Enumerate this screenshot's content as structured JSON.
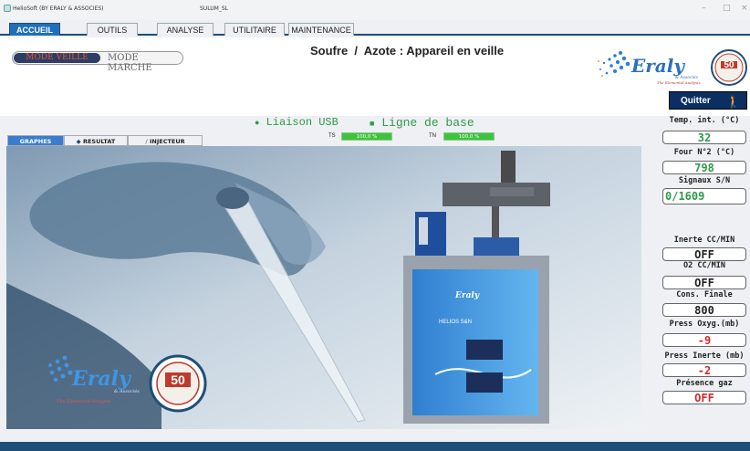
{
  "window": {
    "app_title": "HelioSoft (BY ERALY & ASSOCIES)",
    "file_name": "SULUM_SL"
  },
  "menu": {
    "tabs": [
      {
        "label": "ACCUEIL",
        "active": true
      },
      {
        "label": "OUTILS",
        "active": false
      },
      {
        "label": "ANALYSE",
        "active": false
      },
      {
        "label": "UTILITAIRE",
        "active": false
      },
      {
        "label": "MAINTENANCE",
        "active": false
      }
    ]
  },
  "mode": {
    "veille_label": "MODE VEILLE",
    "marche_label": "MODE MARCHE",
    "selected": "MODE VEILLE"
  },
  "status": {
    "title": "Soufre  /  Azote : Appareil en veille"
  },
  "quit": {
    "label": "Quitter"
  },
  "connection": {
    "usb_label": "Liaison USB",
    "baseline_label": "Ligne de base"
  },
  "gauges": [
    {
      "label": "TS",
      "value": "100,0 %",
      "fill": 1.0
    },
    {
      "label": "TN",
      "value": "100,0 %",
      "fill": 1.0
    }
  ],
  "subtabs": [
    {
      "label": "GRAPHES",
      "icon": "chart-icon",
      "active": true
    },
    {
      "label": "RESULTAT",
      "icon": "results-icon",
      "active": false
    },
    {
      "label": "INJECTEUR",
      "icon": "syringe-icon",
      "active": false
    }
  ],
  "side_panel": [
    {
      "label": "Temp. int. (°C)",
      "value": "32",
      "color": "#2e9a4a"
    },
    {
      "label": "Four N°2 (°C)",
      "value": "798",
      "color": "#2e9a4a"
    },
    {
      "label": "Signaux S/N",
      "value": "0/1609",
      "color": "#2e9a4a"
    },
    {
      "label": "Inerte CC/MIN",
      "value": "OFF",
      "color": "#222222"
    },
    {
      "label": "O2  CC/MIN",
      "value": "OFF",
      "color": "#222222"
    },
    {
      "label": "Cons. Finale",
      "value": "800",
      "color": "#222222"
    },
    {
      "label": "Press Oxyg.(mb)",
      "value": "-9",
      "color": "#d8262c"
    },
    {
      "label": "Press Inerte (mb)",
      "value": "-2",
      "color": "#d8262c"
    },
    {
      "label": "Présence gaz",
      "value": "OFF",
      "color": "#d8262c"
    }
  ],
  "branding": {
    "logo_text": "Eraly",
    "logo_sub": "& Associés",
    "tagline": "The Elemental Analysis",
    "badge_number": "50",
    "instrument_label": "HELIOS S&N"
  },
  "colors": {
    "accent": "#1f6fb8",
    "navy": "#0b2f63",
    "green": "#2e9a4a",
    "red": "#d8262c"
  }
}
